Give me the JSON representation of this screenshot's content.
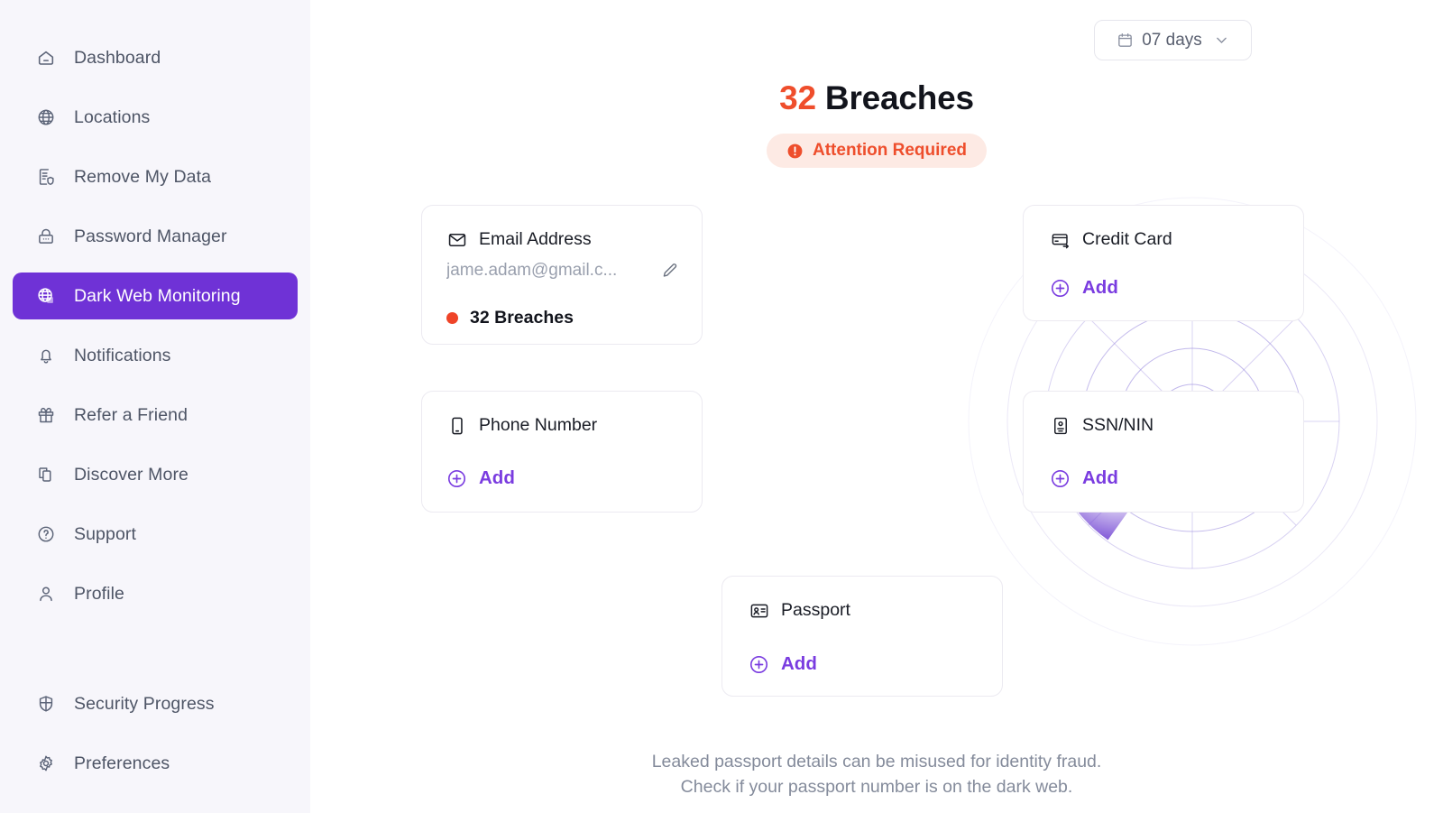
{
  "sidebar": {
    "items": [
      {
        "label": "Dashboard",
        "icon": "home-icon",
        "active": false
      },
      {
        "label": "Locations",
        "icon": "globe-icon",
        "active": false
      },
      {
        "label": "Remove My Data",
        "icon": "file-shield-icon",
        "active": false
      },
      {
        "label": "Password Manager",
        "icon": "lock-icon",
        "active": false
      },
      {
        "label": "Dark Web Monitoring",
        "icon": "globe-scan-icon",
        "active": true
      },
      {
        "label": "Notifications",
        "icon": "bell-icon",
        "active": false
      },
      {
        "label": "Refer a Friend",
        "icon": "gift-icon",
        "active": false
      },
      {
        "label": "Discover More",
        "icon": "copy-icon",
        "active": false
      },
      {
        "label": "Support",
        "icon": "question-circle-icon",
        "active": false
      },
      {
        "label": "Profile",
        "icon": "user-icon",
        "active": false
      }
    ],
    "bottom_items": [
      {
        "label": "Security Progress",
        "icon": "shield-icon",
        "active": false
      },
      {
        "label": "Preferences",
        "icon": "gear-icon",
        "active": false
      }
    ],
    "active_bg": "#6F32D6",
    "bg": "#F7F6FB"
  },
  "header": {
    "date_filter": {
      "label": "07 days",
      "calendar_icon": "calendar-icon",
      "chevron_icon": "chevron-down-icon"
    },
    "breach_count": "32",
    "breach_word": "Breaches",
    "count_color": "#EF4E2C",
    "attention": {
      "label": "Attention Required",
      "icon": "alert-circle-icon",
      "bg": "#FDEAE4",
      "color": "#EE4E2C"
    }
  },
  "cards": {
    "email": {
      "title": "Email Address",
      "icon": "mail-icon",
      "value": "jame.adam@gmail.c...",
      "edit_icon": "pencil-icon",
      "breaches": "32 Breaches",
      "status_dot_color": "#EF4428"
    },
    "phone": {
      "title": "Phone Number",
      "icon": "phone-icon",
      "add_label": "Add",
      "add_icon": "plus-circle-icon"
    },
    "credit": {
      "title": "Credit Card",
      "icon": "credit-card-icon",
      "add_label": "Add",
      "add_icon": "plus-circle-icon"
    },
    "ssn": {
      "title": "SSN/NIN",
      "icon": "id-card-icon",
      "add_label": "Add",
      "add_icon": "plus-circle-icon"
    },
    "passport": {
      "title": "Passport",
      "icon": "passport-icon",
      "add_label": "Add",
      "add_icon": "plus-circle-icon"
    }
  },
  "radar": {
    "rings": 6,
    "spokes": 8,
    "sweep_start_deg": 180,
    "sweep_end_deg": 235,
    "sweep_color": "#7C52D6",
    "grid_color": "#8E7BDE"
  },
  "footer": {
    "line1": "Leaked passport details can be misused for identity fraud.",
    "line2": "Check if your passport number is on the dark web."
  }
}
